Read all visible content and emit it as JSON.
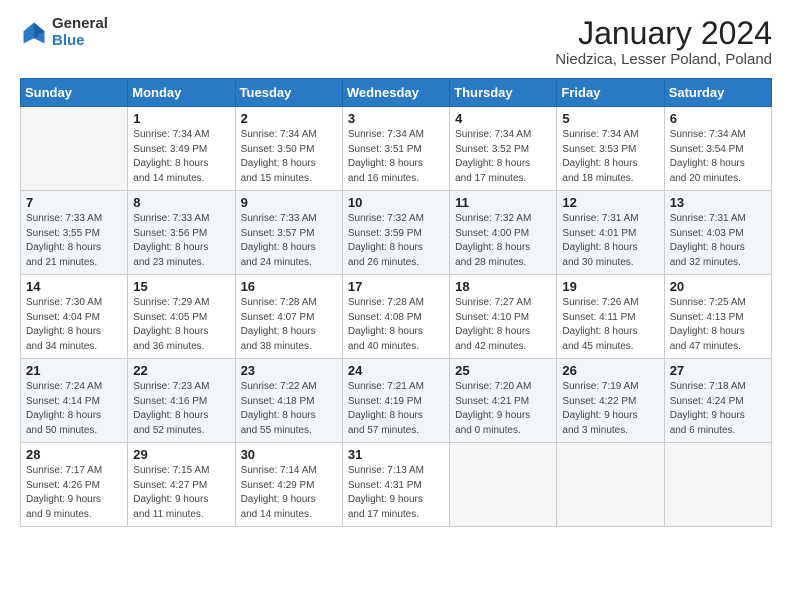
{
  "logo": {
    "general": "General",
    "blue": "Blue"
  },
  "header": {
    "title": "January 2024",
    "subtitle": "Niedzica, Lesser Poland, Poland"
  },
  "days_of_week": [
    "Sunday",
    "Monday",
    "Tuesday",
    "Wednesday",
    "Thursday",
    "Friday",
    "Saturday"
  ],
  "weeks": [
    [
      {
        "day": "",
        "detail": ""
      },
      {
        "day": "1",
        "detail": "Sunrise: 7:34 AM\nSunset: 3:49 PM\nDaylight: 8 hours\nand 14 minutes."
      },
      {
        "day": "2",
        "detail": "Sunrise: 7:34 AM\nSunset: 3:50 PM\nDaylight: 8 hours\nand 15 minutes."
      },
      {
        "day": "3",
        "detail": "Sunrise: 7:34 AM\nSunset: 3:51 PM\nDaylight: 8 hours\nand 16 minutes."
      },
      {
        "day": "4",
        "detail": "Sunrise: 7:34 AM\nSunset: 3:52 PM\nDaylight: 8 hours\nand 17 minutes."
      },
      {
        "day": "5",
        "detail": "Sunrise: 7:34 AM\nSunset: 3:53 PM\nDaylight: 8 hours\nand 18 minutes."
      },
      {
        "day": "6",
        "detail": "Sunrise: 7:34 AM\nSunset: 3:54 PM\nDaylight: 8 hours\nand 20 minutes."
      }
    ],
    [
      {
        "day": "7",
        "detail": "Sunrise: 7:33 AM\nSunset: 3:55 PM\nDaylight: 8 hours\nand 21 minutes."
      },
      {
        "day": "8",
        "detail": "Sunrise: 7:33 AM\nSunset: 3:56 PM\nDaylight: 8 hours\nand 23 minutes."
      },
      {
        "day": "9",
        "detail": "Sunrise: 7:33 AM\nSunset: 3:57 PM\nDaylight: 8 hours\nand 24 minutes."
      },
      {
        "day": "10",
        "detail": "Sunrise: 7:32 AM\nSunset: 3:59 PM\nDaylight: 8 hours\nand 26 minutes."
      },
      {
        "day": "11",
        "detail": "Sunrise: 7:32 AM\nSunset: 4:00 PM\nDaylight: 8 hours\nand 28 minutes."
      },
      {
        "day": "12",
        "detail": "Sunrise: 7:31 AM\nSunset: 4:01 PM\nDaylight: 8 hours\nand 30 minutes."
      },
      {
        "day": "13",
        "detail": "Sunrise: 7:31 AM\nSunset: 4:03 PM\nDaylight: 8 hours\nand 32 minutes."
      }
    ],
    [
      {
        "day": "14",
        "detail": "Sunrise: 7:30 AM\nSunset: 4:04 PM\nDaylight: 8 hours\nand 34 minutes."
      },
      {
        "day": "15",
        "detail": "Sunrise: 7:29 AM\nSunset: 4:05 PM\nDaylight: 8 hours\nand 36 minutes."
      },
      {
        "day": "16",
        "detail": "Sunrise: 7:28 AM\nSunset: 4:07 PM\nDaylight: 8 hours\nand 38 minutes."
      },
      {
        "day": "17",
        "detail": "Sunrise: 7:28 AM\nSunset: 4:08 PM\nDaylight: 8 hours\nand 40 minutes."
      },
      {
        "day": "18",
        "detail": "Sunrise: 7:27 AM\nSunset: 4:10 PM\nDaylight: 8 hours\nand 42 minutes."
      },
      {
        "day": "19",
        "detail": "Sunrise: 7:26 AM\nSunset: 4:11 PM\nDaylight: 8 hours\nand 45 minutes."
      },
      {
        "day": "20",
        "detail": "Sunrise: 7:25 AM\nSunset: 4:13 PM\nDaylight: 8 hours\nand 47 minutes."
      }
    ],
    [
      {
        "day": "21",
        "detail": "Sunrise: 7:24 AM\nSunset: 4:14 PM\nDaylight: 8 hours\nand 50 minutes."
      },
      {
        "day": "22",
        "detail": "Sunrise: 7:23 AM\nSunset: 4:16 PM\nDaylight: 8 hours\nand 52 minutes."
      },
      {
        "day": "23",
        "detail": "Sunrise: 7:22 AM\nSunset: 4:18 PM\nDaylight: 8 hours\nand 55 minutes."
      },
      {
        "day": "24",
        "detail": "Sunrise: 7:21 AM\nSunset: 4:19 PM\nDaylight: 8 hours\nand 57 minutes."
      },
      {
        "day": "25",
        "detail": "Sunrise: 7:20 AM\nSunset: 4:21 PM\nDaylight: 9 hours\nand 0 minutes."
      },
      {
        "day": "26",
        "detail": "Sunrise: 7:19 AM\nSunset: 4:22 PM\nDaylight: 9 hours\nand 3 minutes."
      },
      {
        "day": "27",
        "detail": "Sunrise: 7:18 AM\nSunset: 4:24 PM\nDaylight: 9 hours\nand 6 minutes."
      }
    ],
    [
      {
        "day": "28",
        "detail": "Sunrise: 7:17 AM\nSunset: 4:26 PM\nDaylight: 9 hours\nand 9 minutes."
      },
      {
        "day": "29",
        "detail": "Sunrise: 7:15 AM\nSunset: 4:27 PM\nDaylight: 9 hours\nand 11 minutes."
      },
      {
        "day": "30",
        "detail": "Sunrise: 7:14 AM\nSunset: 4:29 PM\nDaylight: 9 hours\nand 14 minutes."
      },
      {
        "day": "31",
        "detail": "Sunrise: 7:13 AM\nSunset: 4:31 PM\nDaylight: 9 hours\nand 17 minutes."
      },
      {
        "day": "",
        "detail": ""
      },
      {
        "day": "",
        "detail": ""
      },
      {
        "day": "",
        "detail": ""
      }
    ]
  ]
}
